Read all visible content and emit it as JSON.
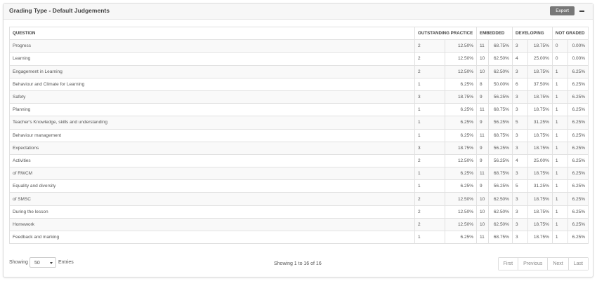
{
  "panel": {
    "title": "Grading Type - Default Judgements",
    "export_label": "Export"
  },
  "table": {
    "headers": [
      "QUESTION",
      "OUTSTANDING PRACTICE",
      "EMBEDDED",
      "DEVELOPING",
      "NOT GRADED"
    ],
    "rows": [
      {
        "question": "Progress",
        "op_n": "2",
        "op_p": "12.50%",
        "em_n": "11",
        "em_p": "68.75%",
        "dv_n": "3",
        "dv_p": "18.75%",
        "ng_n": "0",
        "ng_p": "0.00%"
      },
      {
        "question": "Learning",
        "op_n": "2",
        "op_p": "12.50%",
        "em_n": "10",
        "em_p": "62.50%",
        "dv_n": "4",
        "dv_p": "25.00%",
        "ng_n": "0",
        "ng_p": "0.00%"
      },
      {
        "question": "Engagement in Learning",
        "op_n": "2",
        "op_p": "12.50%",
        "em_n": "10",
        "em_p": "62.50%",
        "dv_n": "3",
        "dv_p": "18.75%",
        "ng_n": "1",
        "ng_p": "6.25%"
      },
      {
        "question": "Behaviour and Climate for Learning",
        "op_n": "1",
        "op_p": "6.25%",
        "em_n": "8",
        "em_p": "50.00%",
        "dv_n": "6",
        "dv_p": "37.50%",
        "ng_n": "1",
        "ng_p": "6.25%"
      },
      {
        "question": "Safety",
        "op_n": "3",
        "op_p": "18.75%",
        "em_n": "9",
        "em_p": "56.25%",
        "dv_n": "3",
        "dv_p": "18.75%",
        "ng_n": "1",
        "ng_p": "6.25%"
      },
      {
        "question": "Planning",
        "op_n": "1",
        "op_p": "6.25%",
        "em_n": "11",
        "em_p": "68.75%",
        "dv_n": "3",
        "dv_p": "18.75%",
        "ng_n": "1",
        "ng_p": "6.25%"
      },
      {
        "question": "Teacher's Knowledge, skills and understanding",
        "op_n": "1",
        "op_p": "6.25%",
        "em_n": "9",
        "em_p": "56.25%",
        "dv_n": "5",
        "dv_p": "31.25%",
        "ng_n": "1",
        "ng_p": "6.25%"
      },
      {
        "question": "Behaviour management",
        "op_n": "1",
        "op_p": "6.25%",
        "em_n": "11",
        "em_p": "68.75%",
        "dv_n": "3",
        "dv_p": "18.75%",
        "ng_n": "1",
        "ng_p": "6.25%"
      },
      {
        "question": "Expectations",
        "op_n": "3",
        "op_p": "18.75%",
        "em_n": "9",
        "em_p": "56.25%",
        "dv_n": "3",
        "dv_p": "18.75%",
        "ng_n": "1",
        "ng_p": "6.25%"
      },
      {
        "question": "Activities",
        "op_n": "2",
        "op_p": "12.50%",
        "em_n": "9",
        "em_p": "56.25%",
        "dv_n": "4",
        "dv_p": "25.00%",
        "ng_n": "1",
        "ng_p": "6.25%"
      },
      {
        "question": "of RWCM",
        "op_n": "1",
        "op_p": "6.25%",
        "em_n": "11",
        "em_p": "68.75%",
        "dv_n": "3",
        "dv_p": "18.75%",
        "ng_n": "1",
        "ng_p": "6.25%"
      },
      {
        "question": "Equality and diversity",
        "op_n": "1",
        "op_p": "6.25%",
        "em_n": "9",
        "em_p": "56.25%",
        "dv_n": "5",
        "dv_p": "31.25%",
        "ng_n": "1",
        "ng_p": "6.25%"
      },
      {
        "question": "of SMSC",
        "op_n": "2",
        "op_p": "12.50%",
        "em_n": "10",
        "em_p": "62.50%",
        "dv_n": "3",
        "dv_p": "18.75%",
        "ng_n": "1",
        "ng_p": "6.25%"
      },
      {
        "question": "During the lesson",
        "op_n": "2",
        "op_p": "12.50%",
        "em_n": "10",
        "em_p": "62.50%",
        "dv_n": "3",
        "dv_p": "18.75%",
        "ng_n": "1",
        "ng_p": "6.25%"
      },
      {
        "question": "Homework",
        "op_n": "2",
        "op_p": "12.50%",
        "em_n": "10",
        "em_p": "62.50%",
        "dv_n": "3",
        "dv_p": "18.75%",
        "ng_n": "1",
        "ng_p": "6.25%"
      },
      {
        "question": "Feedback and marking",
        "op_n": "1",
        "op_p": "6.25%",
        "em_n": "11",
        "em_p": "68.75%",
        "dv_n": "3",
        "dv_p": "18.75%",
        "ng_n": "1",
        "ng_p": "6.25%"
      }
    ]
  },
  "footer": {
    "showing_label": "Showing",
    "entries_value": "50",
    "entries_label": "Entries",
    "info": "Showing 1 to 16 of 16",
    "pager": [
      "First",
      "Previous",
      "Next",
      "Last"
    ]
  }
}
